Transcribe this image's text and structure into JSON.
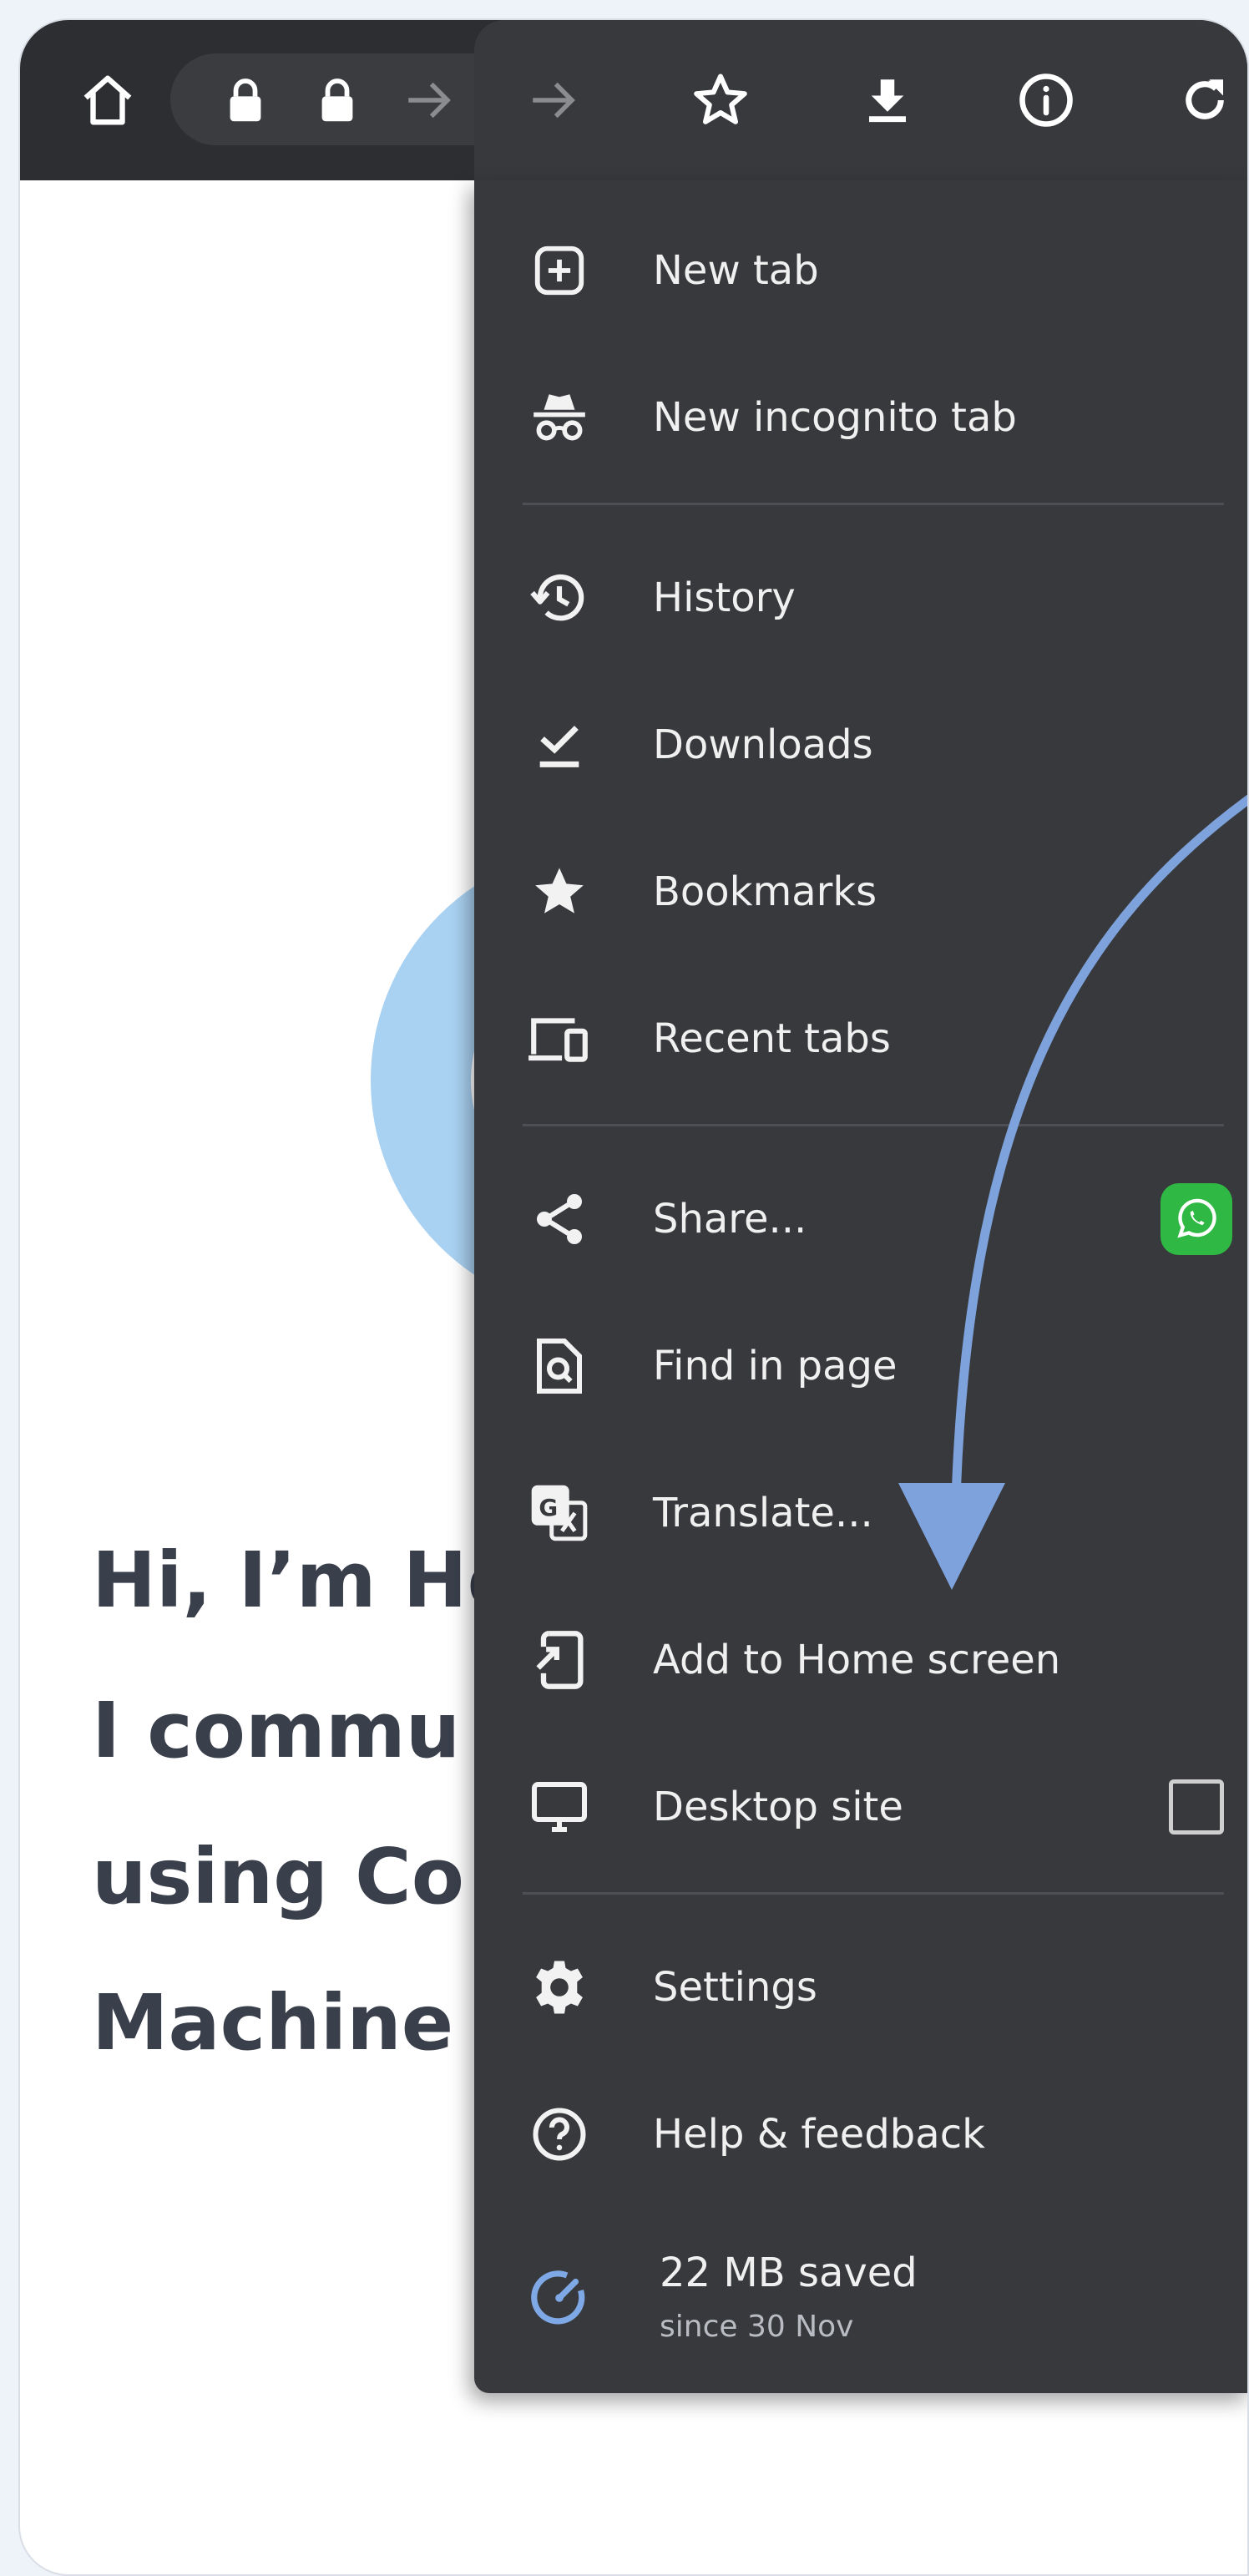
{
  "toolbar": {
    "home_icon": "home-icon",
    "url_icons": [
      "lock-icon",
      "lock-icon",
      "forward-arrow-icon"
    ],
    "forward_icon": "forward-arrow-icon",
    "bookmark_icon": "star-outline-icon",
    "download_icon": "download-icon",
    "info_icon": "info-icon",
    "refresh_icon": "refresh-icon"
  },
  "page": {
    "intro_lines": [
      "Hi, I’m He",
      "I commu",
      "using Co",
      "Machine"
    ]
  },
  "menu": {
    "items": [
      {
        "label": "New tab",
        "icon": "plus-box-icon"
      },
      {
        "label": "New incognito tab",
        "icon": "incognito-icon"
      },
      {
        "label": "History",
        "icon": "history-icon"
      },
      {
        "label": "Downloads",
        "icon": "download-check-icon"
      },
      {
        "label": "Bookmarks",
        "icon": "star-icon"
      },
      {
        "label": "Recent tabs",
        "icon": "devices-icon"
      },
      {
        "label": "Share...",
        "icon": "share-icon",
        "extra_icon": "whatsapp-icon"
      },
      {
        "label": "Find in page",
        "icon": "find-in-page-icon"
      },
      {
        "label": "Translate...",
        "icon": "translate-icon"
      },
      {
        "label": "Add to Home screen",
        "icon": "add-to-home-icon"
      },
      {
        "label": "Desktop site",
        "icon": "desktop-icon",
        "checkbox_checked": false
      },
      {
        "label": "Settings",
        "icon": "gear-icon"
      },
      {
        "label": "Help & feedback",
        "icon": "help-icon"
      }
    ],
    "data_saver": {
      "label": "22 MB saved",
      "sublabel": "since 30 Nov",
      "icon": "speedometer-icon"
    }
  },
  "colors": {
    "toolbar_bg": "#2c2e31",
    "menu_bg": "#38393d",
    "annotation_arrow": "#7ea3dc",
    "whatsapp_green": "#2fb844",
    "page_circle": "#a9d1f2",
    "intro_text": "#3a3f4c"
  }
}
